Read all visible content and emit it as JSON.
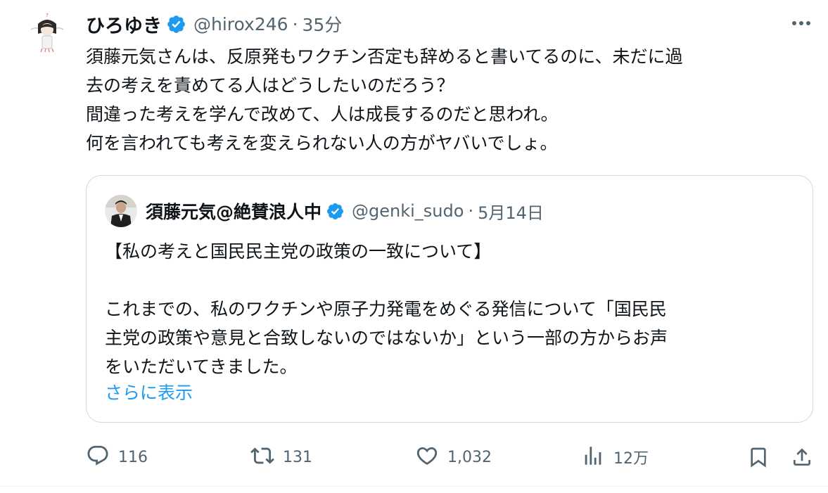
{
  "tweet": {
    "author": {
      "display_name": "ひろゆき",
      "handle": "@hirox246",
      "time": "35分",
      "separator": "·"
    },
    "text_lines": [
      "須藤元気さんは、反原発もワクチン否定も辞めると書いてるのに、未だに過",
      "去の考えを責めてる人はどうしたいのだろう？",
      "間違った考えを学んで改めて、人は成長するのだと思われ。",
      "何を言われても考えを変えられない人の方がヤバいでしょ。"
    ],
    "quote": {
      "display_name": "須藤元気@絶賛浪人中",
      "handle": "@genki_sudo",
      "separator": "·",
      "time": "5月14日",
      "text_lines": [
        "【私の考えと国民民主党の政策の一致について】",
        "",
        "これまでの、私のワクチンや原子力発電をめぐる発信について「国民民",
        "主党の政策や意見と合致しないのではないか」という一部の方からお声",
        "をいただいてきました。"
      ],
      "show_more": "さらに表示"
    },
    "actions": {
      "replies": "116",
      "reposts": "131",
      "likes": "1,032",
      "views": "12万"
    }
  },
  "icons": {
    "verified": "verified-badge-icon",
    "more": "more-horizontal-icon",
    "reply": "reply-icon",
    "repost": "repost-icon",
    "like": "heart-icon",
    "views": "views-chart-icon",
    "bookmark": "bookmark-icon",
    "share": "share-icon"
  },
  "colors": {
    "accent": "#1d9bf0",
    "text": "#0f1419",
    "secondary": "#536471",
    "border": "#cfd9de"
  }
}
